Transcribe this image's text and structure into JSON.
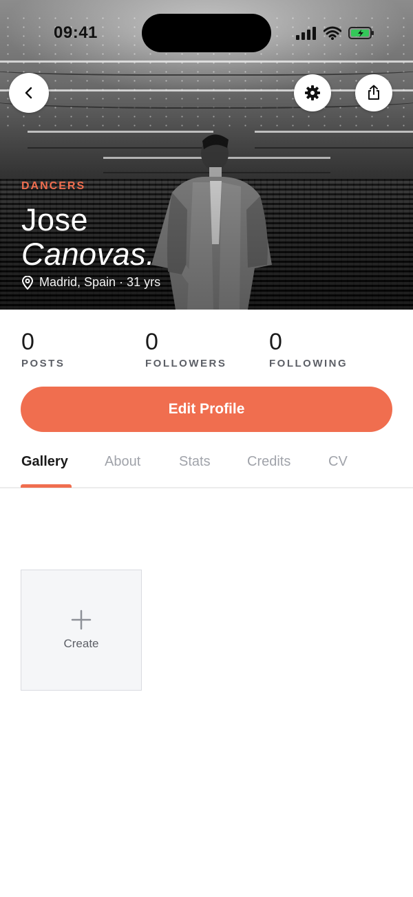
{
  "status_bar": {
    "time": "09:41"
  },
  "profile": {
    "category": "DANCERS",
    "first_name": "Jose",
    "last_name": "Canovas.",
    "location_line": "Madrid, Spain · 31 yrs"
  },
  "stats": [
    {
      "value": "0",
      "label": "POSTS"
    },
    {
      "value": "0",
      "label": "FOLLOWERS"
    },
    {
      "value": "0",
      "label": "FOLLOWING"
    }
  ],
  "actions": {
    "edit_profile": "Edit Profile"
  },
  "tabs": [
    {
      "label": "Gallery",
      "active": true
    },
    {
      "label": "About",
      "active": false
    },
    {
      "label": "Stats",
      "active": false
    },
    {
      "label": "Credits",
      "active": false
    },
    {
      "label": "CV",
      "active": false
    }
  ],
  "gallery": {
    "create_label": "Create"
  },
  "colors": {
    "accent": "#f06e4f",
    "muted_text": "#a0a3aa",
    "stat_label": "#5c5f66",
    "battery": "#34c759"
  },
  "icons": {
    "back": "chevron-left-icon",
    "settings": "gear-icon",
    "share": "share-icon",
    "location": "map-pin-icon",
    "create": "plus-icon"
  }
}
